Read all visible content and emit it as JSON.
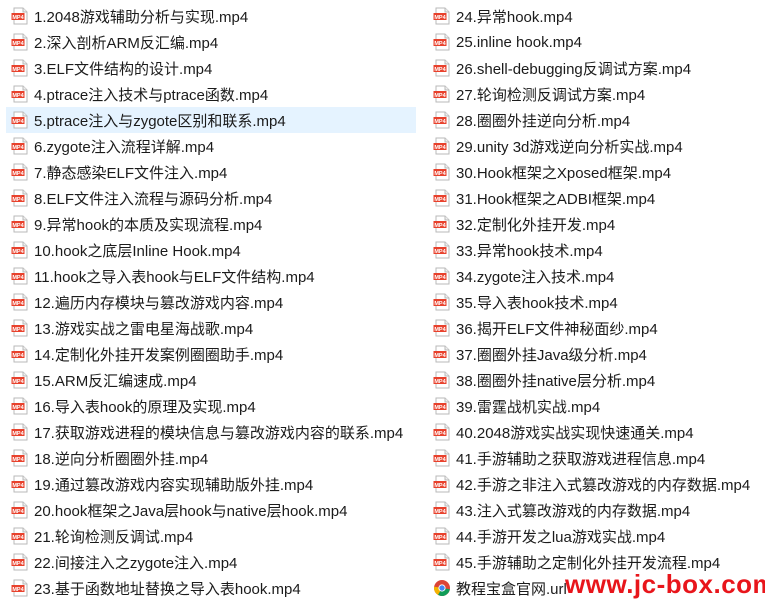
{
  "files_left": [
    {
      "name": "1.2048游戏辅助分析与实现.mp4",
      "icon": "mp4-file-icon"
    },
    {
      "name": "2.深入剖析ARM反汇编.mp4",
      "icon": "mp4-file-icon"
    },
    {
      "name": "3.ELF文件结构的设计.mp4",
      "icon": "mp4-file-icon"
    },
    {
      "name": "4.ptrace注入技术与ptrace函数.mp4",
      "icon": "mp4-file-icon"
    },
    {
      "name": "5.ptrace注入与zygote区别和联系.mp4",
      "icon": "mp4-file-icon",
      "selected": true
    },
    {
      "name": "6.zygote注入流程详解.mp4",
      "icon": "mp4-file-icon"
    },
    {
      "name": "7.静态感染ELF文件注入.mp4",
      "icon": "mp4-file-icon"
    },
    {
      "name": "8.ELF文件注入流程与源码分析.mp4",
      "icon": "mp4-file-icon"
    },
    {
      "name": "9.异常hook的本质及实现流程.mp4",
      "icon": "mp4-file-icon"
    },
    {
      "name": "10.hook之底层Inline Hook.mp4",
      "icon": "mp4-file-icon"
    },
    {
      "name": "11.hook之导入表hook与ELF文件结构.mp4",
      "icon": "mp4-file-icon"
    },
    {
      "name": "12.遍历内存模块与篡改游戏内容.mp4",
      "icon": "mp4-file-icon"
    },
    {
      "name": "13.游戏实战之雷电星海战歌.mp4",
      "icon": "mp4-file-icon"
    },
    {
      "name": "14.定制化外挂开发案例圈圈助手.mp4",
      "icon": "mp4-file-icon"
    },
    {
      "name": "15.ARM反汇编速成.mp4",
      "icon": "mp4-file-icon"
    },
    {
      "name": "16.导入表hook的原理及实现.mp4",
      "icon": "mp4-file-icon"
    },
    {
      "name": "17.获取游戏进程的模块信息与篡改游戏内容的联系.mp4",
      "icon": "mp4-file-icon"
    },
    {
      "name": "18.逆向分析圈圈外挂.mp4",
      "icon": "mp4-file-icon"
    },
    {
      "name": "19.通过篡改游戏内容实现辅助版外挂.mp4",
      "icon": "mp4-file-icon"
    },
    {
      "name": "20.hook框架之Java层hook与native层hook.mp4",
      "icon": "mp4-file-icon"
    },
    {
      "name": "21.轮询检测反调试.mp4",
      "icon": "mp4-file-icon"
    },
    {
      "name": "22.间接注入之zygote注入.mp4",
      "icon": "mp4-file-icon"
    },
    {
      "name": "23.基于函数地址替换之导入表hook.mp4",
      "icon": "mp4-file-icon"
    }
  ],
  "files_right": [
    {
      "name": "24.异常hook.mp4",
      "icon": "mp4-file-icon"
    },
    {
      "name": "25.inline hook.mp4",
      "icon": "mp4-file-icon"
    },
    {
      "name": "26.shell-debugging反调试方案.mp4",
      "icon": "mp4-file-icon"
    },
    {
      "name": "27.轮询检测反调试方案.mp4",
      "icon": "mp4-file-icon"
    },
    {
      "name": "28.圈圈外挂逆向分析.mp4",
      "icon": "mp4-file-icon"
    },
    {
      "name": "29.unity 3d游戏逆向分析实战.mp4",
      "icon": "mp4-file-icon"
    },
    {
      "name": "30.Hook框架之Xposed框架.mp4",
      "icon": "mp4-file-icon"
    },
    {
      "name": "31.Hook框架之ADBI框架.mp4",
      "icon": "mp4-file-icon"
    },
    {
      "name": "32.定制化外挂开发.mp4",
      "icon": "mp4-file-icon"
    },
    {
      "name": "33.异常hook技术.mp4",
      "icon": "mp4-file-icon"
    },
    {
      "name": "34.zygote注入技术.mp4",
      "icon": "mp4-file-icon"
    },
    {
      "name": "35.导入表hook技术.mp4",
      "icon": "mp4-file-icon"
    },
    {
      "name": "36.揭开ELF文件神秘面纱.mp4",
      "icon": "mp4-file-icon"
    },
    {
      "name": "37.圈圈外挂Java级分析.mp4",
      "icon": "mp4-file-icon"
    },
    {
      "name": "38.圈圈外挂native层分析.mp4",
      "icon": "mp4-file-icon"
    },
    {
      "name": "39.雷霆战机实战.mp4",
      "icon": "mp4-file-icon"
    },
    {
      "name": "40.2048游戏实战实现快速通关.mp4",
      "icon": "mp4-file-icon"
    },
    {
      "name": "41.手游辅助之获取游戏进程信息.mp4",
      "icon": "mp4-file-icon"
    },
    {
      "name": "42.手游之非注入式篡改游戏的内存数据.mp4",
      "icon": "mp4-file-icon"
    },
    {
      "name": "43.注入式篡改游戏的内存数据.mp4",
      "icon": "mp4-file-icon"
    },
    {
      "name": "44.手游开发之lua游戏实战.mp4",
      "icon": "mp4-file-icon"
    },
    {
      "name": "45.手游辅助之定制化外挂开发流程.mp4",
      "icon": "mp4-file-icon"
    },
    {
      "name": "教程宝盒官网.url",
      "icon": "chrome-icon"
    }
  ],
  "icon_badge_text": "MP4",
  "watermark": "www.jc-box.com",
  "colors": {
    "icon_red": "#e8412c",
    "selected_bg": "#e5f3ff",
    "watermark": "#e8151b"
  }
}
